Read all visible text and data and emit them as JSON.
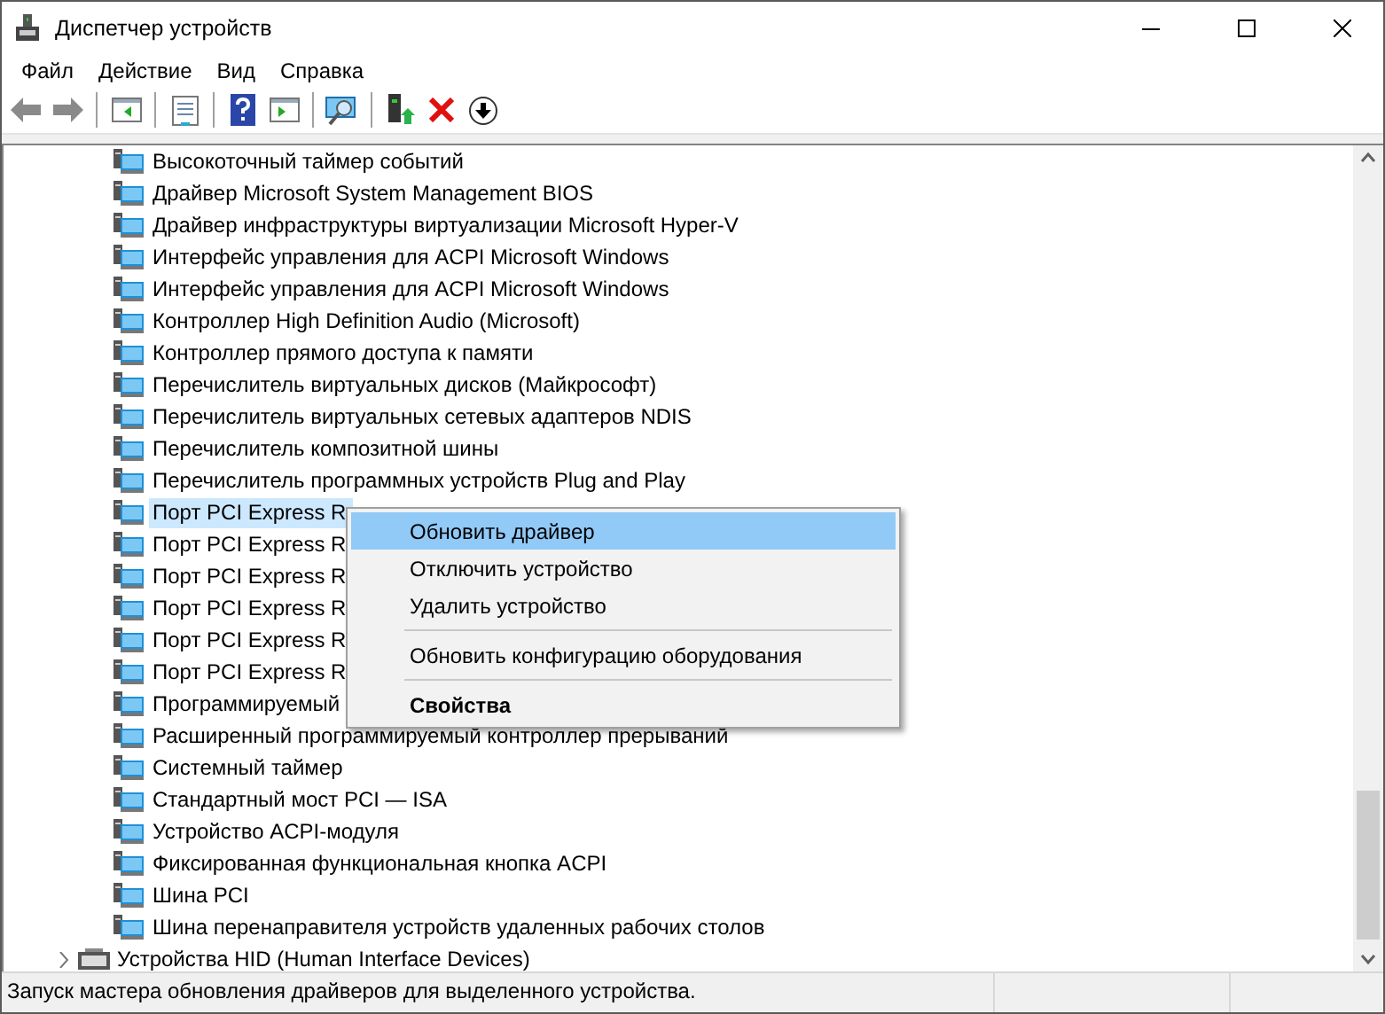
{
  "window": {
    "title": "Диспетчер устройств"
  },
  "menu": [
    {
      "label": "Файл"
    },
    {
      "label": "Действие"
    },
    {
      "label": "Вид"
    },
    {
      "label": "Справка"
    }
  ],
  "toolbar": [
    {
      "kind": "back"
    },
    {
      "kind": "forward"
    },
    {
      "kind": "sep"
    },
    {
      "kind": "tree"
    },
    {
      "kind": "sep"
    },
    {
      "kind": "props"
    },
    {
      "kind": "sep"
    },
    {
      "kind": "help"
    },
    {
      "kind": "pane"
    },
    {
      "kind": "sep"
    },
    {
      "kind": "scan"
    },
    {
      "kind": "sep"
    },
    {
      "kind": "update"
    },
    {
      "kind": "remove"
    },
    {
      "kind": "disable"
    }
  ],
  "tree": [
    {
      "kind": "device",
      "label": "Высокоточный таймер событий",
      "selected": false
    },
    {
      "kind": "device",
      "label": "Драйвер Microsoft System Management BIOS",
      "selected": false
    },
    {
      "kind": "device",
      "label": "Драйвер инфраструктуры виртуализации Microsoft Hyper-V",
      "selected": false
    },
    {
      "kind": "device",
      "label": "Интерфейс управления для ACPI Microsoft Windows",
      "selected": false
    },
    {
      "kind": "device",
      "label": "Интерфейс управления для ACPI Microsoft Windows",
      "selected": false
    },
    {
      "kind": "device",
      "label": "Контроллер High Definition Audio (Microsoft)",
      "selected": false
    },
    {
      "kind": "device",
      "label": "Контроллер прямого доступа к памяти",
      "selected": false
    },
    {
      "kind": "device",
      "label": "Перечислитель виртуальных дисков (Майкрософт)",
      "selected": false
    },
    {
      "kind": "device",
      "label": "Перечислитель виртуальных сетевых адаптеров NDIS",
      "selected": false
    },
    {
      "kind": "device",
      "label": "Перечислитель композитной шины",
      "selected": false
    },
    {
      "kind": "device",
      "label": "Перечислитель программных устройств Plug and Play",
      "selected": false
    },
    {
      "kind": "device",
      "label": "Порт PCI Express R",
      "selected": true
    },
    {
      "kind": "device",
      "label": "Порт PCI Express R",
      "selected": false
    },
    {
      "kind": "device",
      "label": "Порт PCI Express R",
      "selected": false
    },
    {
      "kind": "device",
      "label": "Порт PCI Express R",
      "selected": false
    },
    {
      "kind": "device",
      "label": "Порт PCI Express R",
      "selected": false
    },
    {
      "kind": "device",
      "label": "Порт PCI Express R",
      "selected": false
    },
    {
      "kind": "device",
      "label": "Программируемый",
      "selected": false
    },
    {
      "kind": "device",
      "label": "Расширенный программируемый контроллер прерываний",
      "selected": false
    },
    {
      "kind": "device",
      "label": "Системный таймер",
      "selected": false
    },
    {
      "kind": "device",
      "label": "Стандартный мост PCI — ISA",
      "selected": false
    },
    {
      "kind": "device",
      "label": "Устройство ACPI-модуля",
      "selected": false
    },
    {
      "kind": "device",
      "label": "Фиксированная функциональная кнопка ACPI",
      "selected": false
    },
    {
      "kind": "device",
      "label": "Шина PCI",
      "selected": false
    },
    {
      "kind": "device",
      "label": "Шина перенаправителя устройств удаленных рабочих столов",
      "selected": false
    },
    {
      "kind": "category",
      "label": "Устройства HID (Human Interface Devices)",
      "expanded": false
    }
  ],
  "context_menu": [
    {
      "kind": "item",
      "label": "Обновить драйвер",
      "selected": true,
      "default": false
    },
    {
      "kind": "item",
      "label": "Отключить устройство",
      "selected": false,
      "default": false
    },
    {
      "kind": "item",
      "label": "Удалить устройство",
      "selected": false,
      "default": false
    },
    {
      "kind": "separator"
    },
    {
      "kind": "item",
      "label": "Обновить конфигурацию оборудования",
      "selected": false,
      "default": false
    },
    {
      "kind": "separator"
    },
    {
      "kind": "item",
      "label": "Свойства",
      "selected": false,
      "default": true
    }
  ],
  "status_bar": {
    "text": "Запуск мастера обновления драйверов для выделенного устройства."
  }
}
